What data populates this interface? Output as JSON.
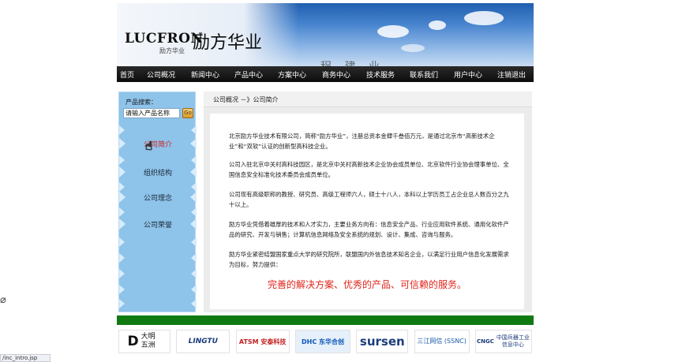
{
  "header": {
    "logo_latin": "LUCFRON",
    "logo_cn": "励方华业",
    "logo_sub": "励方华业",
    "banner_text": "程 建 业"
  },
  "nav": {
    "items": [
      "首页",
      "公司概况",
      "新闻中心",
      "产品中心",
      "方案中心",
      "商务中心",
      "技术服务",
      "联系我们",
      "用户中心",
      "注销退出"
    ]
  },
  "sidebar": {
    "search_label": "产品搜索：",
    "search_value": "请输入产品名称",
    "search_button": "Go",
    "items": [
      "公司简介",
      "组织结构",
      "公司理念",
      "公司荣誉"
    ],
    "active_index": 0
  },
  "main": {
    "breadcrumb": "公司概况 －》公司简介",
    "paragraphs": [
      "北京励方华业技术有限公司，简称“励方华业”，注册总资本金肆千叁佰万元，是通过北京市“高新技术企业”和“双软”认证的创新型高科技企业。",
      "公司入驻北京中关村高科技园区，是北京中关村高新技术企业协会成员单位、北京软件行业协会理事单位、全国信息安全标准化技术委员会成员单位。",
      "公司现有高级职称的教授、研究员、高级工程师六人，硕士十八人，本科以上学历员工占企业总人数百分之九十以上。",
      "励方华业凭借着雄厚的技术和人才实力，主要业务方向有：信息安全产品、行业应用软件系统、通用化软件产品的研究、开发与销售；计算机信息网络及安全系统的规划、设计、集成、咨询与服务。",
      "励方华业紧密结盟国家重点大学的研究院所，联盟国内外信息技术知名企业，以满足行业用户信息化发展需求为目标，努力提供："
    ],
    "slogan": "完善的解决方案、优秀的产品、可信赖的服务。"
  },
  "footer": {
    "partners": [
      {
        "name": "大明五洲",
        "mark": "D"
      },
      {
        "name": "LINGTU"
      },
      {
        "name": "ATSM 安泰科技"
      },
      {
        "name": "DHC 东华合创"
      },
      {
        "name": "sursen"
      },
      {
        "name": "三江网信 (SSNC)"
      },
      {
        "name": "中国兵器工业信息中心",
        "mark": "CNGC"
      }
    ]
  },
  "status": {
    "url": "/inc_intro.jsp"
  }
}
